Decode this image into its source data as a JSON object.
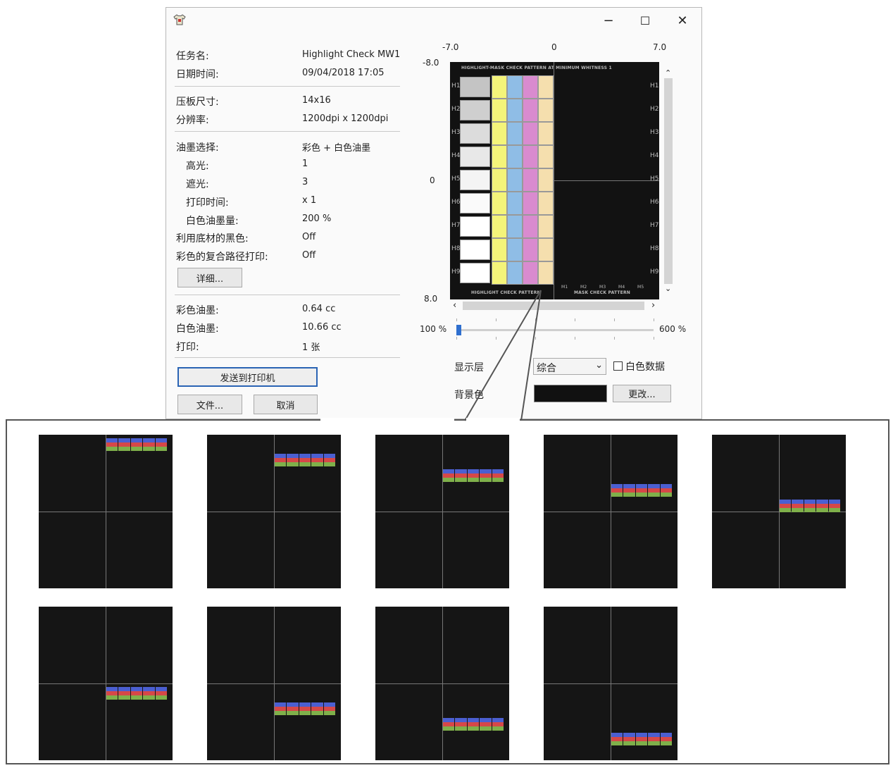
{
  "window": {
    "app_icon": "shirt-icon",
    "controls": {
      "minimize": "−",
      "maximize": "☐",
      "close": "✕"
    }
  },
  "job": {
    "name_label": "任务名:",
    "name_value": "Highlight Check MW1",
    "date_label": "日期时间:",
    "date_value": "09/04/2018 17:05",
    "platen_label": "压板尺寸:",
    "platen_value": "14x16",
    "resolution_label": "分辨率:",
    "resolution_value": "1200dpi x 1200dpi",
    "ink_label": "油墨选择:",
    "ink_value": "彩色 + 白色油墨",
    "highlight_label": "高光:",
    "highlight_value": "1",
    "mask_label": "遮光:",
    "mask_value": "3",
    "print_time_label": "打印时间:",
    "print_time_value": "x 1",
    "white_ink_amount_label": "白色油墨量:",
    "white_ink_amount_value": "200 %",
    "black_base_label": "利用底材的黑色:",
    "black_base_value": "Off",
    "multi_pass_label": "彩色的复合路径打印:",
    "multi_pass_value": "Off",
    "details_button": "详细...",
    "color_ink_label": "彩色油墨:",
    "color_ink_value": "0.64 cc",
    "white_ink_label": "白色油墨:",
    "white_ink_value": "10.66 cc",
    "prints_label": "打印:",
    "prints_value": "1 张",
    "send_button": "发送到打印机",
    "file_button": "文件...",
    "cancel_button": "取消"
  },
  "preview": {
    "x_axis": [
      "-7.0",
      "0",
      "7.0"
    ],
    "y_axis": [
      "-8.0",
      "0",
      "8.0"
    ],
    "header_text": "HIGHLIGHT-MASK CHECK PATTERN AT MINIMUM WHITNESS 1",
    "row_labels": [
      "H1",
      "H2",
      "H3",
      "H4",
      "H5",
      "H6",
      "H7",
      "H8",
      "H9"
    ],
    "mask_labels": [
      "M1",
      "M2",
      "M3",
      "M4",
      "M5"
    ],
    "footer_left": "HIGHLIGHT CHECK PATTERN",
    "footer_right": "MASK CHECK PATTERN",
    "swatch_grays": [
      "#c4c4c4",
      "#cfcfcf",
      "#dcdcdc",
      "#e8e8e8",
      "#f4f4f4",
      "#fafafa",
      "#ffffff",
      "#ffffff",
      "#ffffff"
    ],
    "stripe_colors": [
      "#f4f47a",
      "#8fbde6",
      "#d98bcf",
      "#f5dfae"
    ]
  },
  "zoom": {
    "min_label": "100 %",
    "max_label": "600 %",
    "level_fraction": 0.0
  },
  "display": {
    "layer_label": "显示层",
    "layer_value": "综合",
    "white_data_label": "白色数据",
    "white_data_checked": false,
    "background_label": "背景色",
    "background_color": "#111111",
    "change_button": "更改..."
  },
  "thumbnails": {
    "stripe_colors": [
      "#4b5fd1",
      "#d64848",
      "#7fb04a"
    ],
    "bar_vertical_fraction": [
      0.05,
      0.15,
      0.25,
      0.35,
      0.45,
      0.55,
      0.65,
      0.75,
      0.85
    ]
  }
}
